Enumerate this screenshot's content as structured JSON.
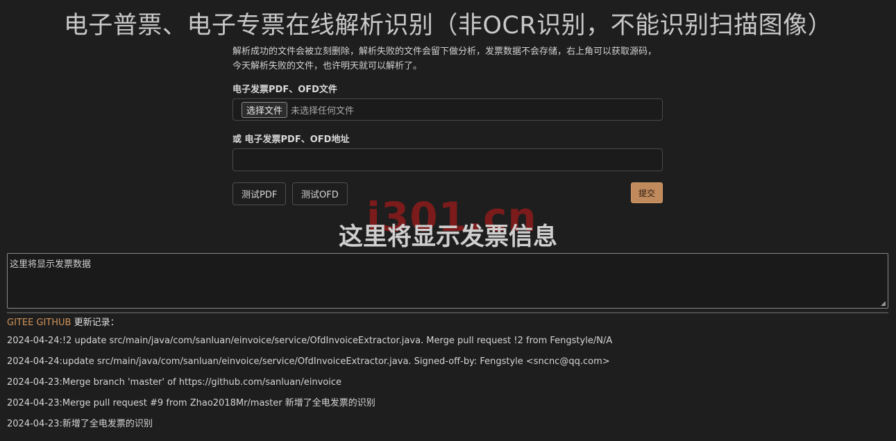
{
  "header": {
    "title": "电子普票、电子专票在线解析识别（非OCR识别，不能识别扫描图像）"
  },
  "form": {
    "description": "解析成功的文件会被立刻删除，解析失败的文件会留下做分析，发票数据不会存储，右上角可以获取源码，今天解析失败的文件，也许明天就可以解析了。",
    "file_label": "电子发票PDF、OFD文件",
    "file_button_label": "选择文件",
    "file_status": "未选择任何文件",
    "url_label": "或 电子发票PDF、OFD地址",
    "url_value": "",
    "test_pdf_label": "测试PDF",
    "test_ofd_label": "测试OFD",
    "submit_label": "提交"
  },
  "watermark": {
    "text": "i301.cn",
    "color": "#c81919"
  },
  "result": {
    "heading": "这里将显示发票信息",
    "textarea_value": "这里将显示发票数据"
  },
  "changelog": {
    "gitee_label": "GITEE",
    "github_label": "GITHUB",
    "header_label": " 更新记录：",
    "items": [
      "2024-04-24:!2 update src/main/java/com/sanluan/einvoice/service/OfdInvoiceExtractor.java. Merge pull request !2 from Fengstyle/N/A",
      "2024-04-24:update src/main/java/com/sanluan/einvoice/service/OfdInvoiceExtractor.java. Signed-off-by: Fengstyle <sncnc@qq.com>",
      "2024-04-23:Merge branch 'master' of https://github.com/sanluan/einvoice",
      "2024-04-23:Merge pull request #9 from Zhao2018Mr/master 新增了全电发票的识别",
      "2024-04-23:新增了全电发票的识别"
    ]
  },
  "colors": {
    "background": "#1e1e1e",
    "accent_link": "#d2935a",
    "submit": "#c08a5c"
  }
}
